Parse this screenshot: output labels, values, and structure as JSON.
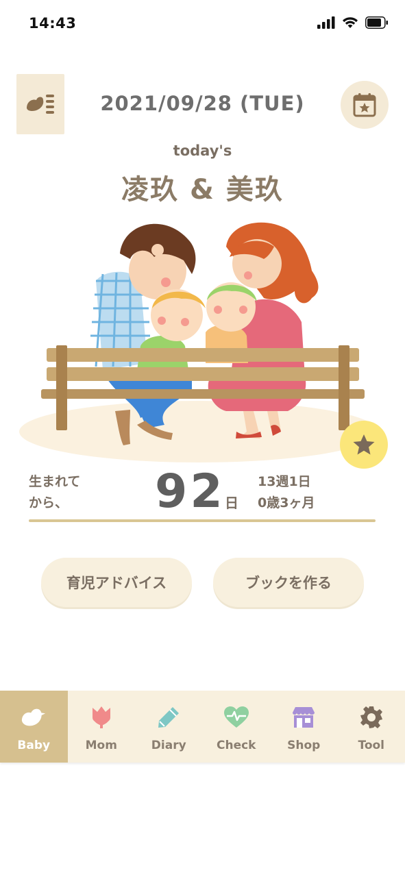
{
  "status": {
    "time": "14:43"
  },
  "header": {
    "date": "2021/09/28 (TUE)"
  },
  "today": {
    "prefix": "today's",
    "names": "凌玖 & 美玖"
  },
  "age_info": {
    "since_line1": "生まれて",
    "since_line2": "から、",
    "days": "92",
    "days_unit": "日",
    "weeks": "13週1日",
    "months": "0歳3ヶ月"
  },
  "actions": {
    "advice_label": "育児アドバイス",
    "book_label": "ブックを作る"
  },
  "tabs": [
    {
      "label": "Baby",
      "icon": "bird-icon",
      "active": true
    },
    {
      "label": "Mom",
      "icon": "tulip-icon"
    },
    {
      "label": "Diary",
      "icon": "pencil-icon"
    },
    {
      "label": "Check",
      "icon": "heart-pulse-icon"
    },
    {
      "label": "Shop",
      "icon": "shop-icon"
    },
    {
      "label": "Tool",
      "icon": "gear-icon"
    }
  ],
  "colors": {
    "accent_beige": "#f4ead6",
    "active_tab": "#d6c08f",
    "star_yellow": "#fbe67a",
    "text_brown": "#7a6e62",
    "tab_mom": "#f08a8a",
    "tab_diary": "#7ec7c4",
    "tab_check": "#8fd0a0",
    "tab_shop": "#a78fd6",
    "tab_tool": "#7a6a5a"
  }
}
